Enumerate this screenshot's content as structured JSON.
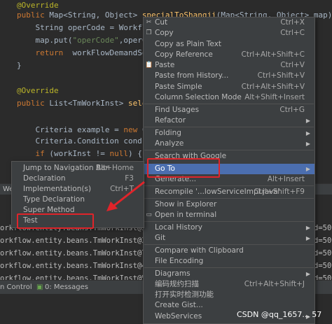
{
  "editor": {
    "lines": [
      {
        "id": "l1",
        "parts": [
          {
            "t": "@Override",
            "c": "ann"
          }
        ]
      },
      {
        "id": "l2",
        "parts": [
          {
            "t": "public ",
            "c": "kw"
          },
          {
            "t": "Map<String, Object> ",
            "c": ""
          },
          {
            "t": "specialToShangji",
            "c": "mth"
          },
          {
            "t": "(Map<String, Object> map){",
            "c": ""
          }
        ]
      },
      {
        "id": "l3",
        "parts": [
          {
            "t": "    String ",
            "c": ""
          },
          {
            "t": "operCode",
            "c": ""
          },
          {
            "t": " = WorkflowC",
            "c": ""
          }
        ]
      },
      {
        "id": "l4",
        "parts": [
          {
            "t": "    map.put(",
            "c": ""
          },
          {
            "t": "\"operCode\"",
            "c": "str"
          },
          {
            "t": ",operCode",
            "c": ""
          }
        ]
      },
      {
        "id": "l5",
        "parts": [
          {
            "t": "    ",
            "c": ""
          },
          {
            "t": "return ",
            "c": "kw"
          },
          {
            "t": " workFlowDemandServi",
            "c": ""
          }
        ]
      },
      {
        "id": "l6",
        "parts": [
          {
            "t": "}",
            "c": ""
          }
        ]
      },
      {
        "id": "l7",
        "parts": [
          {
            "t": "",
            "c": ""
          }
        ]
      },
      {
        "id": "l8",
        "parts": [
          {
            "t": "@Override",
            "c": "ann"
          }
        ]
      },
      {
        "id": "l9",
        "parts": [
          {
            "t": "public ",
            "c": "kw"
          },
          {
            "t": "List<TmWorkInst> ",
            "c": ""
          },
          {
            "t": "selectW",
            "c": "mth"
          }
        ]
      },
      {
        "id": "l10",
        "parts": [
          {
            "t": "",
            "c": ""
          }
        ]
      },
      {
        "id": "l11",
        "parts": [
          {
            "t": "    Criteria example = ",
            "c": ""
          },
          {
            "t": "new ",
            "c": "kw"
          },
          {
            "t": "Crit",
            "c": ""
          }
        ]
      },
      {
        "id": "l12",
        "parts": [
          {
            "t": "    Criteria.Condition cond",
            "c": ""
          }
        ]
      },
      {
        "id": "l13",
        "parts": [
          {
            "t": "    ",
            "c": ""
          },
          {
            "t": "if ",
            "c": "kw"
          },
          {
            "t": "(workInst != ",
            "c": ""
          },
          {
            "t": "null",
            "c": "kw"
          },
          {
            "t": ") {",
            "c": ""
          }
        ]
      }
    ]
  },
  "tool_window": {
    "tab": "We"
  },
  "console": {
    "lines": [
      "orkflow.entity.beans.TmWorkInst@59e7",
      "orkflow.entity.beans.TmWorkInst@307a",
      "orkflow.entity.beans.TmWorkInst@76a6",
      "orkflow.entity.beans.TmWorkInst@4bcd",
      "orkflow.entity.beans.TmWorkInst@5514"
    ],
    "right_lines": [
      "d=500",
      "d=500",
      "d=500",
      "d=500",
      "d=500",
      "d=500"
    ]
  },
  "statusbar": {
    "version_control": "n Control",
    "messages": "0: Messages"
  },
  "right_menu": {
    "items": [
      {
        "label": "Cut",
        "shortcut": "Ctrl+X",
        "icon": "✂"
      },
      {
        "label": "Copy",
        "shortcut": "Ctrl+C",
        "icon": "❐"
      },
      {
        "label": "Copy as Plain Text",
        "shortcut": ""
      },
      {
        "label": "Copy Reference",
        "shortcut": "Ctrl+Alt+Shift+C"
      },
      {
        "label": "Paste",
        "shortcut": "Ctrl+V",
        "icon": "📋"
      },
      {
        "label": "Paste from History...",
        "shortcut": "Ctrl+Shift+V"
      },
      {
        "label": "Paste Simple",
        "shortcut": "Ctrl+Alt+Shift+V"
      },
      {
        "label": "Column Selection Mode",
        "shortcut": "Alt+Shift+Insert"
      },
      {
        "label": "Find Usages",
        "shortcut": "Ctrl+G"
      },
      {
        "label": "Refactor",
        "submenu": true
      },
      {
        "label": "Folding",
        "submenu": true
      },
      {
        "label": "Analyze",
        "submenu": true
      },
      {
        "label": "Search with Google",
        "shortcut": ""
      },
      {
        "label": "Go To",
        "submenu": true
      },
      {
        "label": "Generate...",
        "shortcut": "Alt+Insert"
      },
      {
        "label": "Recompile '...lowServiceImpl.java'",
        "shortcut": "Ctrl+Shift+F9"
      },
      {
        "label": "Show in Explorer",
        "shortcut": ""
      },
      {
        "label": "Open in terminal",
        "shortcut": "",
        "icon": "▭"
      },
      {
        "label": "Local History",
        "submenu": true
      },
      {
        "label": "Git",
        "submenu": true
      },
      {
        "label": "Compare with Clipboard",
        "shortcut": ""
      },
      {
        "label": "File Encoding",
        "shortcut": ""
      },
      {
        "label": "Diagrams",
        "submenu": true
      },
      {
        "label": "编码规约扫描",
        "shortcut": "Ctrl+Alt+Shift+J"
      },
      {
        "label": "打开实时检测功能",
        "shortcut": ""
      },
      {
        "label": "Create Gist...",
        "shortcut": ""
      },
      {
        "label": "WebServices",
        "submenu": true
      }
    ]
  },
  "goto_menu": {
    "items": [
      {
        "label": "Jump to Navigation Bar",
        "shortcut": "Alt+Home"
      },
      {
        "label": "Declaration",
        "shortcut": "F3"
      },
      {
        "label": "Implementation(s)",
        "shortcut": "Ctrl+T"
      },
      {
        "label": "Type Declaration",
        "shortcut": ""
      },
      {
        "label": "Super Method",
        "shortcut": ""
      },
      {
        "label": "Test",
        "shortcut": ""
      }
    ]
  },
  "watermark": "CSDN @qq_1657... 57",
  "colors": {
    "selection": "#4b6eaf",
    "highlight_box": "#e0242a",
    "menu_bg": "#3c3f41",
    "editor_bg": "#2b2b2b"
  }
}
